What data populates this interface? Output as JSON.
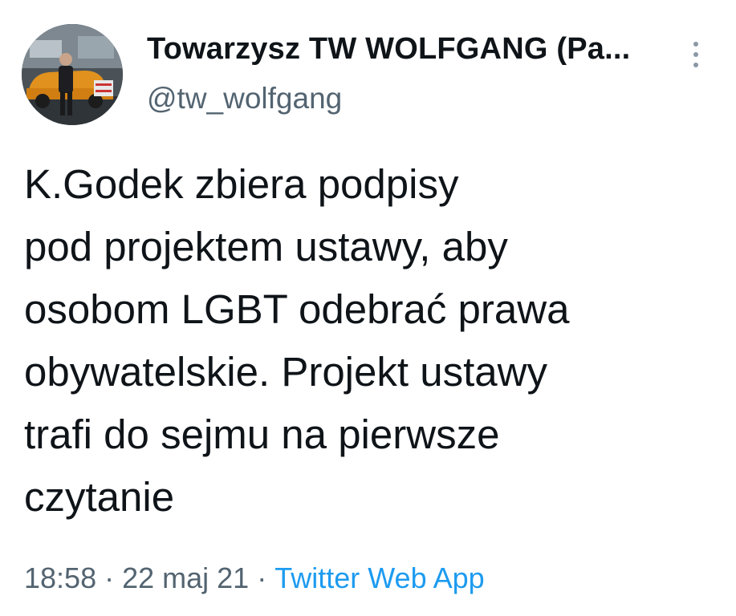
{
  "author": {
    "display_name": "Towarzysz TW WOLFGANG (Pa...",
    "handle": "@tw_wolfgang",
    "avatar_icon": "profile-photo-man-with-orange-car"
  },
  "menu": {
    "icon": "more-vertical-icon"
  },
  "tweet": {
    "lines": [
      "K.Godek zbiera podpisy",
      "pod projektem ustawy, aby",
      "osobom LGBT odebrać prawa",
      "obywatelskie. Projekt ustawy",
      "trafi do sejmu na pierwsze",
      "czytanie"
    ]
  },
  "meta": {
    "time": "18:58",
    "separator": "·",
    "date": "22 maj 21",
    "source": "Twitter Web App"
  },
  "colors": {
    "text": "#0f1419",
    "secondary": "#536471",
    "link": "#1d9bf0"
  }
}
